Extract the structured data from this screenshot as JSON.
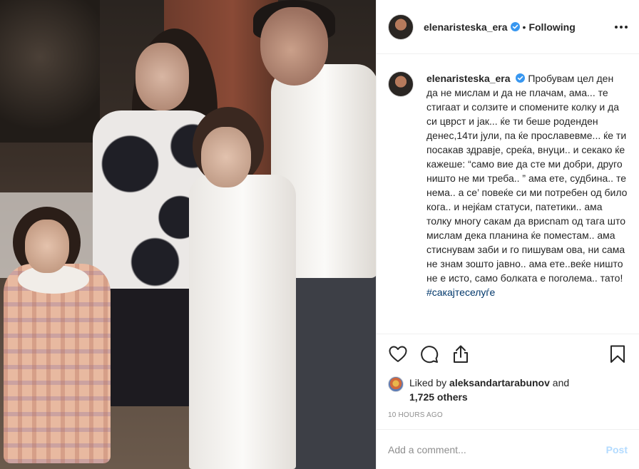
{
  "header": {
    "username": "elenaristeska_era",
    "separator": "•",
    "follow_state": "Following"
  },
  "caption": {
    "username": "elenaristeska_era",
    "text": "Пробувам цел ден да не мислам и да не плачам, ама... те стигаат и солзите и спомените колку и да си цврст и јак... ќе ти беше роденден денес,14ти јули, па ќе прославевме... ќе ти посакав здравје, среќа, внуци.. и секако ќе кажеше: “само вие да сте ми добри, друго ништо не ми треба.. ” ама ете, судбина.. те нема.. а се’ повеќе си ми потребен од било кога.. и нејќам статуси, патетики.. ама толку многу сакам да врисnam од тага што мислам дека планина ќе поместам.. ама стиснувам заби и го пишувам ова, ни сама не знам зошто јавно.. ама ете..веќе ништо не е исто, само болката е поголема.. тато!",
    "hashtag": "#сакајтеселуѓе"
  },
  "likes": {
    "prefix": "Liked by ",
    "user": "aleksandartarabunov",
    "middle": " and",
    "count": "1,725 others"
  },
  "timestamp": "10 HOURS AGO",
  "comment": {
    "placeholder": "Add a comment...",
    "post_label": "Post"
  },
  "colors": {
    "verified": "#3897f0",
    "hashtag": "#00376b",
    "post_disabled": "#b3dbff",
    "muted": "#8e8e8e"
  },
  "icons": [
    "verified-badge-icon",
    "more-options-icon",
    "heart-icon",
    "comment-icon",
    "share-icon",
    "bookmark-icon"
  ]
}
